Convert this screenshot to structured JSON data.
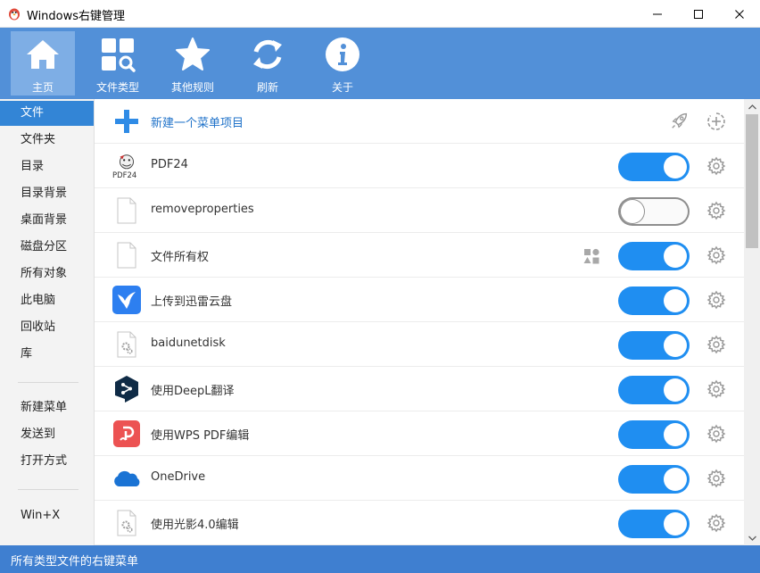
{
  "window": {
    "title": "Windows右键管理"
  },
  "toolbar": {
    "home": "主页",
    "file_types": "文件类型",
    "other_rules": "其他规则",
    "refresh": "刷新",
    "about": "关于"
  },
  "sidebar": {
    "items": [
      "文件",
      "文件夹",
      "目录",
      "目录背景",
      "桌面背景",
      "磁盘分区",
      "所有对象",
      "此电脑",
      "回收站",
      "库"
    ],
    "group2": [
      "新建菜单",
      "发送到",
      "打开方式"
    ],
    "group3": [
      "Win+X"
    ]
  },
  "content": {
    "new_item": "新建一个菜单项目",
    "rows": [
      {
        "label": "PDF24",
        "enabled": true,
        "icon": "pdf24-icon"
      },
      {
        "label": "removeproperties",
        "enabled": false,
        "icon": "blank-file-icon"
      },
      {
        "label": "文件所有权",
        "enabled": true,
        "icon": "blank-file-icon"
      },
      {
        "label": "上传到迅雷云盘",
        "enabled": true,
        "icon": "xunlei-icon"
      },
      {
        "label": "baidunetdisk",
        "enabled": true,
        "icon": "gear-file-icon"
      },
      {
        "label": "使用DeepL翻译",
        "enabled": true,
        "icon": "deepl-icon"
      },
      {
        "label": "使用WPS PDF编辑",
        "enabled": true,
        "icon": "wps-pdf-icon"
      },
      {
        "label": "OneDrive",
        "enabled": true,
        "icon": "onedrive-icon"
      },
      {
        "label": "使用光影4.0编辑",
        "enabled": true,
        "icon": "gear-file-icon"
      }
    ],
    "pdf24_logo_text": "PDF24"
  },
  "status": {
    "text": "所有类型文件的右键菜单"
  },
  "colors": {
    "toolbar": "#5290d8",
    "toolbar_active": "#7eaee5",
    "sidebar_active": "#3385d6",
    "toggle_on": "#1f8ef1",
    "toggle_off": "#8e8e8e",
    "statusbar": "#3f7fd0"
  }
}
